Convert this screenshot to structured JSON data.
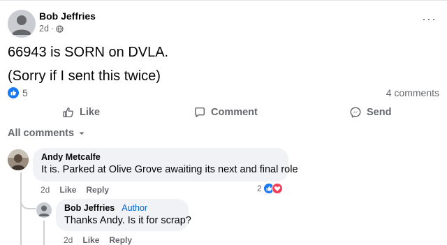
{
  "post": {
    "author": "Bob Jeffries",
    "time": "2d",
    "separator": "·",
    "audience_icon": "globe-icon",
    "more_label": "···",
    "lines": [
      "66943 is SORN on DVLA.",
      "(Sorry if I sent this twice)"
    ],
    "reaction_count": "5",
    "comments_count": "4 comments"
  },
  "actions": {
    "like": "Like",
    "comment": "Comment",
    "send": "Send"
  },
  "comments_filter": "All comments",
  "comments": [
    {
      "name": "Andy Metcalfe",
      "text": "It is. Parked at Olive Grove awaiting its next and final role",
      "time": "2d",
      "like": "Like",
      "reply": "Reply",
      "reaction_count": "2"
    },
    {
      "name": "Bob Jeffries",
      "badge": "Author",
      "text": "Thanks Andy. Is it for scrap?",
      "time": "2d",
      "like": "Like",
      "reply": "Reply"
    }
  ],
  "colors": {
    "like_blue": "#1877f2",
    "love_red": "#f33e58",
    "muted_text": "#65676b",
    "bubble_bg": "#f0f2f5",
    "author_tag": "#0064d1"
  }
}
